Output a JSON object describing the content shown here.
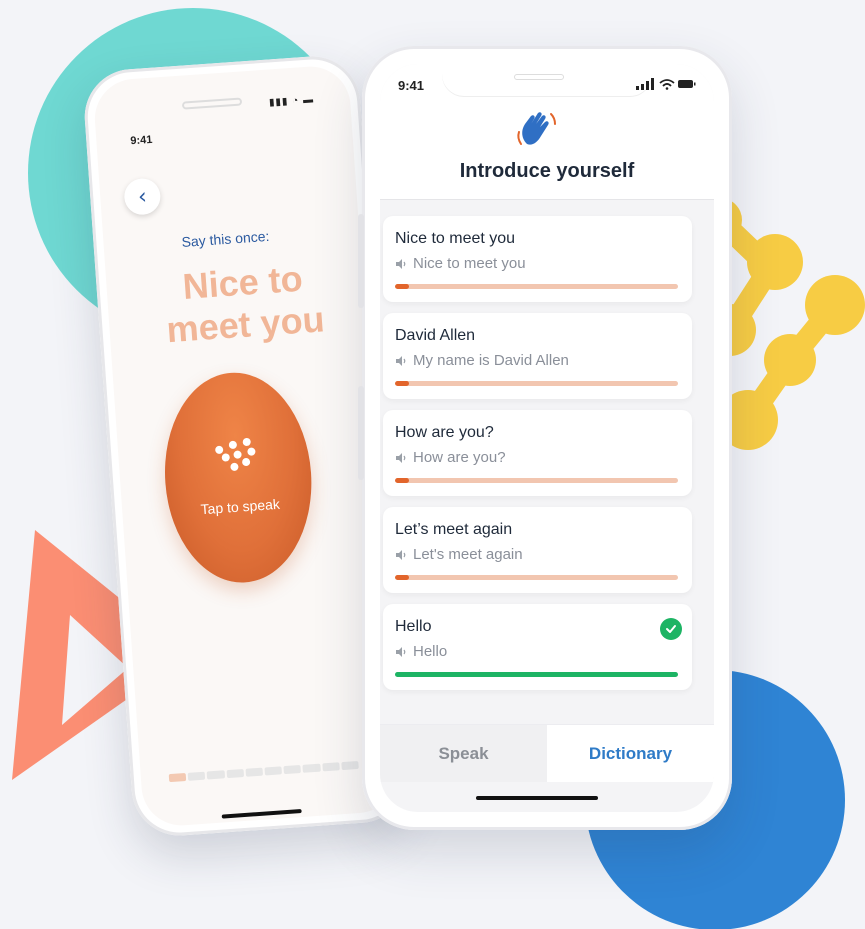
{
  "colors": {
    "accent_orange": "#e2652b",
    "accent_blue": "#2f7bc7",
    "success_green": "#1db464",
    "teal": "#6fd8d2",
    "yellow": "#f7cc44",
    "salmon": "#fb8e73"
  },
  "left_phone": {
    "time": "9:41",
    "back_icon": "chevron-left-icon",
    "instruction": "Say this once:",
    "phrase_line1": "Nice to",
    "phrase_line2": "meet you",
    "speak_button_label": "Tap to speak",
    "progress": {
      "completed_segments": 1,
      "total_segments": 10
    }
  },
  "right_phone": {
    "time": "9:41",
    "header_icon": "waving-hand-icon",
    "title": "Introduce yourself",
    "items": [
      {
        "phrase": "Nice to meet you",
        "audio": "Nice to meet you",
        "progress": 0.05,
        "done": false
      },
      {
        "phrase": "David Allen",
        "audio": "My name is David Allen",
        "progress": 0.05,
        "done": false
      },
      {
        "phrase": "How are you?",
        "audio": "How are you?",
        "progress": 0.05,
        "done": false
      },
      {
        "phrase": "Let’s meet again",
        "audio": "Let's meet again",
        "progress": 0.05,
        "done": false
      },
      {
        "phrase": "Hello",
        "audio": "Hello",
        "progress": 1.0,
        "done": true
      }
    ],
    "tabs": [
      {
        "label": "Speak",
        "active": false
      },
      {
        "label": "Dictionary",
        "active": true
      }
    ]
  }
}
